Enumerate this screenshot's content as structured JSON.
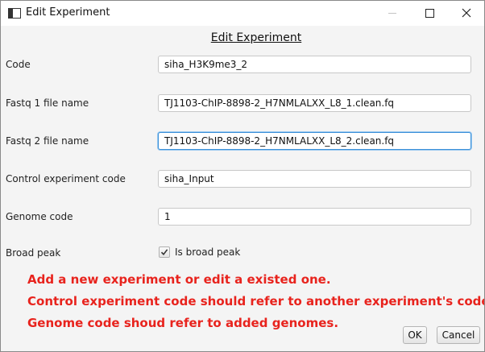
{
  "window": {
    "title": "Edit Experiment",
    "icon": "window-app-icon",
    "controls": [
      "minimize-icon",
      "maximize-icon",
      "close-icon"
    ]
  },
  "dialog": {
    "heading": "Edit Experiment"
  },
  "form": {
    "code": {
      "label": "Code",
      "value": "siha_H3K9me3_2"
    },
    "fastq1": {
      "label": "Fastq 1 file name",
      "value": "TJ1103-ChIP-8898-2_H7NMLALXX_L8_1.clean.fq"
    },
    "fastq2": {
      "label": "Fastq 2 file name",
      "value": "TJ1103-ChIP-8898-2_H7NMLALXX_L8_2.clean.fq"
    },
    "control": {
      "label": "Control experiment code",
      "value": "siha_Input"
    },
    "genome": {
      "label": "Genome code",
      "value": "1"
    },
    "broad_peak": {
      "label": "Broad peak",
      "checkbox_label": "Is broad peak",
      "checked": true
    }
  },
  "notes": [
    "Add a new experiment or edit a existed one.",
    "Control experiment code should refer to another experiment's code.",
    "Genome code shoud refer to added genomes."
  ],
  "buttons": {
    "ok": "OK",
    "cancel": "Cancel"
  },
  "colors": {
    "note_text": "#e8231d",
    "focus_border": "#3a8fd8"
  }
}
